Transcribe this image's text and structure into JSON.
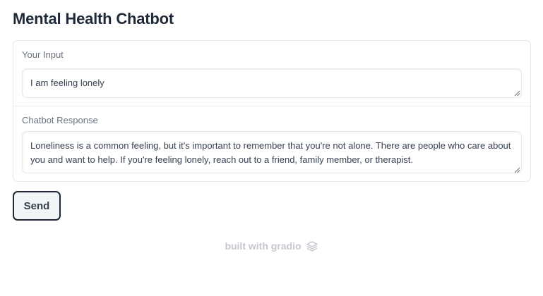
{
  "page": {
    "title": "Mental Health Chatbot"
  },
  "input": {
    "label": "Your Input",
    "value": "I am feeling lonely"
  },
  "output": {
    "label": "Chatbot Response",
    "value": "Loneliness is a common feeling, but it's important to remember that you're not alone. There are people who care about you and want to help. If you're feeling lonely, reach out to a friend, family member, or therapist."
  },
  "actions": {
    "send_label": "Send"
  },
  "footer": {
    "text": "built with gradio",
    "logo_icon": "gradio-logo-icon"
  },
  "colors": {
    "border": "#e5e7eb",
    "label": "#6b7280",
    "button_bg": "#f3f4f6",
    "button_border": "#1f2937",
    "footer_text": "#c4c8ce"
  }
}
